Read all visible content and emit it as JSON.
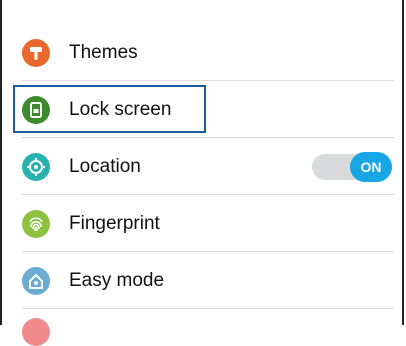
{
  "settings": {
    "items": [
      {
        "label": "Themes",
        "icon": "themes-icon",
        "color": "#e8692c"
      },
      {
        "label": "Lock screen",
        "icon": "lock-screen-icon",
        "color": "#3c8a2e"
      },
      {
        "label": "Location",
        "icon": "location-icon",
        "color": "#27b2ae",
        "toggle": "ON"
      },
      {
        "label": "Fingerprint",
        "icon": "fingerprint-icon",
        "color": "#8cc23f"
      },
      {
        "label": "Easy mode",
        "icon": "easy-mode-icon",
        "color": "#6aaccf"
      }
    ],
    "peek_color": "#f08a8a",
    "toggle_color": "#19a6e4"
  }
}
